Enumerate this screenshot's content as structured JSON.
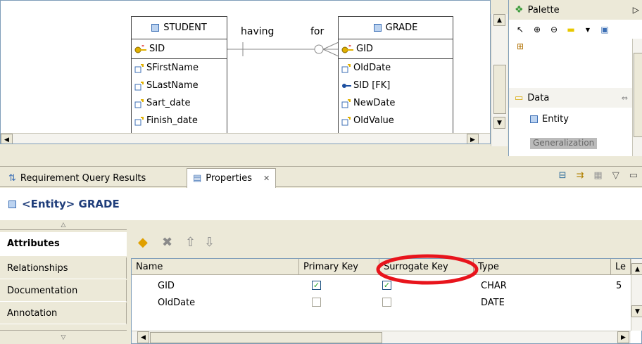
{
  "diagram": {
    "student": {
      "title": "STUDENT",
      "key": "SID",
      "attributes": [
        "SFirstName",
        "SLastName",
        "Sart_date",
        "Finish_date"
      ]
    },
    "grade": {
      "title": "GRADE",
      "key": "GID",
      "attributes": [
        "OldDate",
        "SID [FK]",
        "NewDate",
        "OldValue"
      ]
    },
    "relation_left_label": "having",
    "relation_right_label": "for"
  },
  "palette": {
    "title": "Palette",
    "section": "Data",
    "items": [
      "Entity",
      "Generalization"
    ]
  },
  "tabs": [
    {
      "label": "Requirement Query Results",
      "active": false
    },
    {
      "label": "Properties",
      "active": true,
      "close": "✕"
    }
  ],
  "properties": {
    "title": "<Entity> GRADE",
    "nav": [
      "Attributes",
      "Relationships",
      "Documentation",
      "Annotation"
    ],
    "active_nav": "Attributes",
    "columns": [
      "Name",
      "Primary Key",
      "Surrogate Key",
      "Type",
      "Le"
    ],
    "rows": [
      {
        "name": "GID",
        "primary_key": true,
        "surrogate_key": true,
        "type": "CHAR",
        "length": "5"
      },
      {
        "name": "OldDate",
        "primary_key": false,
        "surrogate_key": false,
        "type": "DATE",
        "length": ""
      }
    ],
    "highlight_color": "#e8141c"
  }
}
